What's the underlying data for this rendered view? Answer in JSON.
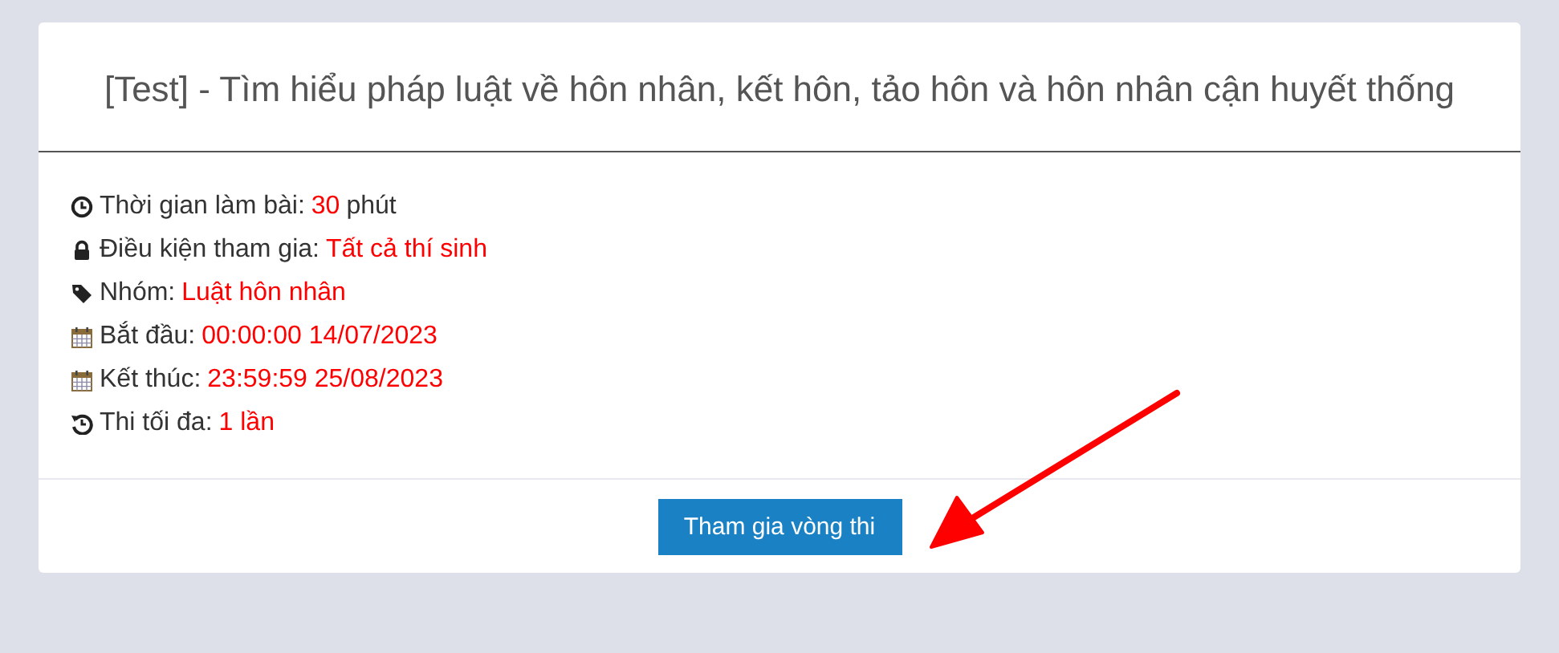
{
  "exam": {
    "title": "[Test] - Tìm hiểu pháp luật về hôn nhân, kết hôn, tảo hôn và hôn nhân cận huyết thống",
    "details": [
      {
        "kind": "duration",
        "label": "Thời gian làm bài:",
        "value": "30",
        "suffix": "phút"
      },
      {
        "kind": "eligibility",
        "label": "Điều kiện tham gia:",
        "value": "Tất cả thí sinh"
      },
      {
        "kind": "group",
        "label": "Nhóm:",
        "value": "Luật hôn nhân"
      },
      {
        "kind": "start",
        "label": "Bắt đầu:",
        "value": "00:00:00 14/07/2023"
      },
      {
        "kind": "end",
        "label": "Kết thúc:",
        "value": "23:59:59 25/08/2023"
      },
      {
        "kind": "attempts",
        "label": "Thi tối đa:",
        "value": "1 lần"
      }
    ],
    "button": "Tham gia vòng thi"
  }
}
